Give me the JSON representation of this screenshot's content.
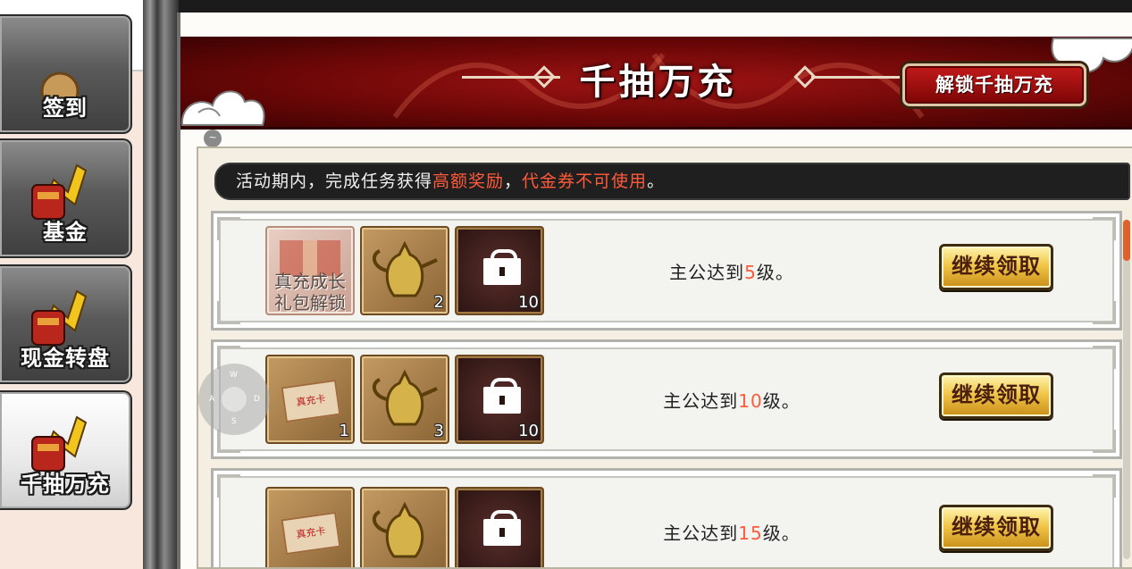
{
  "sidebar": {
    "items": [
      {
        "label": "签到",
        "active": false
      },
      {
        "label": "基金",
        "active": false
      },
      {
        "label": "现金转盘",
        "active": false
      },
      {
        "label": "千抽万充",
        "active": true
      }
    ]
  },
  "banner": {
    "title": "千抽万充",
    "unlock_button": "解锁千抽万充"
  },
  "info_dot": "~",
  "notice": {
    "prefix": "活动期内，完成任务获得",
    "highlight1": "高额奖励",
    "sep": "，",
    "highlight2": "代金券不可使用",
    "suffix": "。"
  },
  "tasks": [
    {
      "condition_prefix": "主公达到",
      "level": "5",
      "condition_suffix": "级。",
      "button": "继续领取",
      "card_label_line1": "真充成长",
      "card_label_line2": "礼包解锁",
      "reward2_qty": "2",
      "reward3_qty": "10"
    },
    {
      "condition_prefix": "主公达到",
      "level": "10",
      "condition_suffix": "级。",
      "button": "继续领取",
      "ticket_text": "真充卡",
      "reward1_qty": "1",
      "reward2_qty": "3",
      "reward3_qty": "10"
    },
    {
      "condition_prefix": "主公达到",
      "level": "15",
      "condition_suffix": "级。",
      "button": "继续领取",
      "ticket_text": "真充卡"
    }
  ],
  "joystick": {
    "up": "W",
    "left": "A",
    "right": "D",
    "down": "S"
  },
  "colors": {
    "accent_red": "#ff5a3a",
    "banner_red": "#a01414",
    "gold_button": "#f1c74a",
    "sidebar_bg": "#f7e7dc"
  }
}
